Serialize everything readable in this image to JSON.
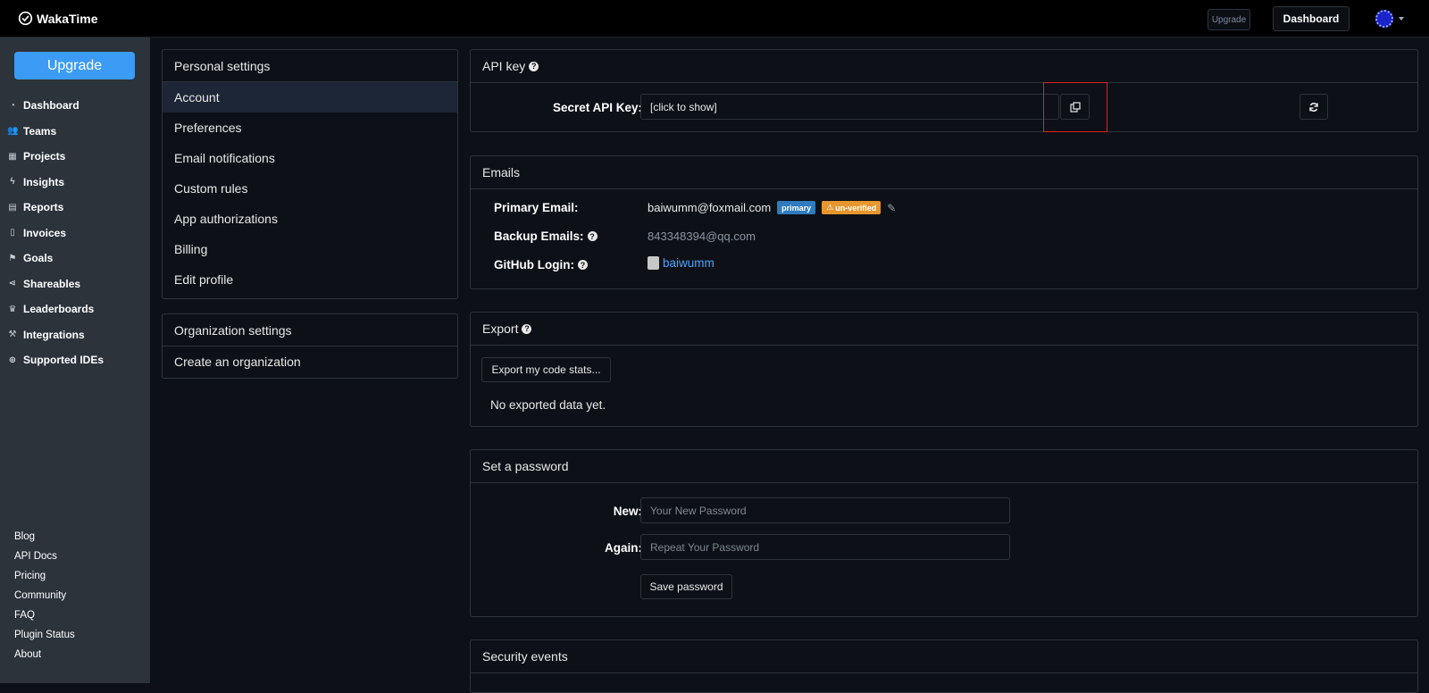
{
  "app": {
    "name": "WakaTime"
  },
  "topbar": {
    "upgrade_label": "Upgrade",
    "dashboard_label": "Dashboard"
  },
  "sidebar": {
    "upgrade_label": "Upgrade",
    "nav": [
      {
        "label": "Dashboard",
        "icon": "dashboard-icon"
      },
      {
        "label": "Teams",
        "icon": "users-icon"
      },
      {
        "label": "Projects",
        "icon": "grid-icon"
      },
      {
        "label": "Insights",
        "icon": "bolt-icon"
      },
      {
        "label": "Reports",
        "icon": "report-icon"
      },
      {
        "label": "Invoices",
        "icon": "invoice-icon"
      },
      {
        "label": "Goals",
        "icon": "flag-icon"
      },
      {
        "label": "Shareables",
        "icon": "share-icon"
      },
      {
        "label": "Leaderboards",
        "icon": "trophy-icon"
      },
      {
        "label": "Integrations",
        "icon": "wrench-icon"
      },
      {
        "label": "Supported IDEs",
        "icon": "plus-circle-icon"
      }
    ],
    "footer_links": [
      "Blog",
      "API Docs",
      "Pricing",
      "Community",
      "FAQ",
      "Plugin Status",
      "About"
    ]
  },
  "settings_nav": {
    "personal_heading": "Personal settings",
    "personal_items": [
      "Account",
      "Preferences",
      "Email notifications",
      "Custom rules",
      "App authorizations",
      "Billing",
      "Edit profile"
    ],
    "active_item": "Account",
    "org_heading": "Organization settings",
    "org_items": [
      "Create an organization"
    ]
  },
  "api_key": {
    "title": "API key",
    "label": "Secret API Key:",
    "value": "[click to show]"
  },
  "emails": {
    "title": "Emails",
    "primary_label": "Primary Email:",
    "primary_value": "baiwumm@foxmail.com",
    "primary_badge": "primary",
    "unverified_badge": "un-verified",
    "backup_label": "Backup Emails:",
    "backup_value": "843348394@qq.com",
    "github_label": "GitHub Login:",
    "github_value": "baiwumm"
  },
  "export": {
    "title": "Export",
    "button_label": "Export my code stats...",
    "status": "No exported data yet."
  },
  "password": {
    "title": "Set a password",
    "new_label": "New:",
    "new_placeholder": "Your New Password",
    "again_label": "Again:",
    "again_placeholder": "Repeat Your Password",
    "save_label": "Save password"
  },
  "security": {
    "title": "Security events"
  },
  "colors": {
    "accent": "#3c9bf5",
    "primary_badge": "#2f7bbf",
    "unverified_badge": "#e8962e",
    "highlight": "#e02020"
  }
}
